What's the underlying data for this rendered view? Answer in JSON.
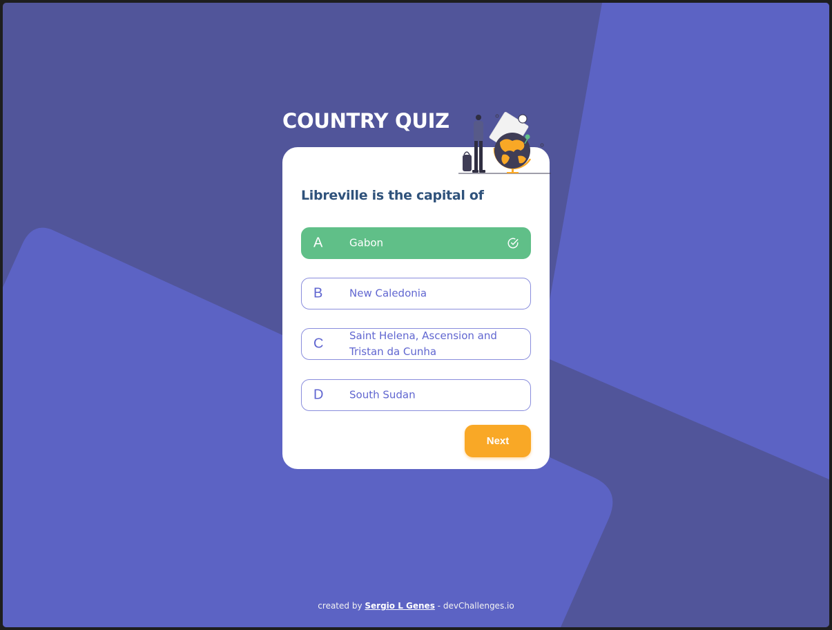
{
  "app": {
    "title": "COUNTRY QUIZ"
  },
  "quiz": {
    "question": "Libreville is the capital of",
    "options": [
      {
        "letter": "A",
        "text": "Gabon",
        "state": "correct"
      },
      {
        "letter": "B",
        "text": "New Caledonia",
        "state": "default"
      },
      {
        "letter": "C",
        "text": "Saint Helena, Ascension and Tristan da Cunha",
        "state": "default"
      },
      {
        "letter": "D",
        "text": "South Sudan",
        "state": "default"
      }
    ],
    "next_label": "Next"
  },
  "footer": {
    "prefix": "created by",
    "author": "Sergio L Genes",
    "separator": "-",
    "site": "devChallenges.io"
  },
  "icons": {
    "check": "check-circle-icon",
    "illustration": "traveler-globe-illustration"
  },
  "colors": {
    "background": "#51559a",
    "background_shape": "#5c63c4",
    "card": "#ffffff",
    "question": "#2f527b",
    "option": "#6066d0",
    "correct": "#60bf88",
    "next_button": "#f9a826"
  }
}
